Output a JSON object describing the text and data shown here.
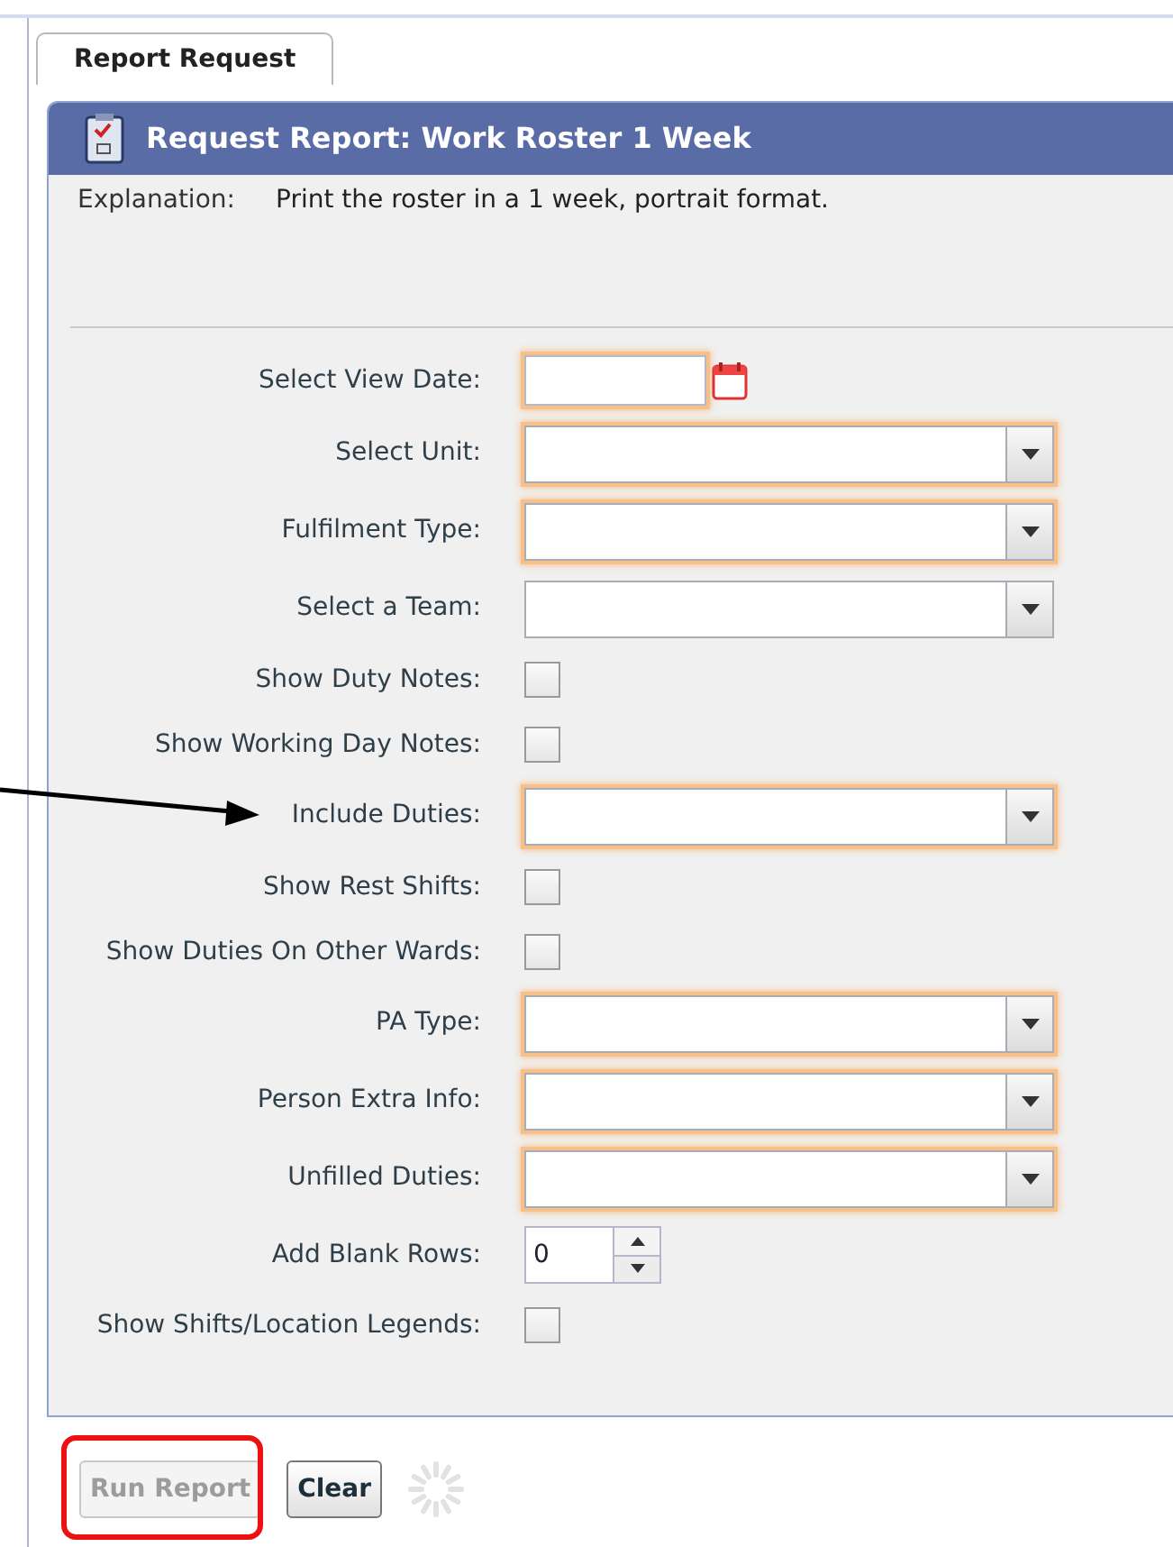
{
  "tab": {
    "label": "Report Request",
    "selected": true
  },
  "panel": {
    "title": "Request Report: Work Roster 1 Week",
    "explanation_label": "Explanation:",
    "explanation": "Print the roster in a 1 week, portrait format."
  },
  "fields": [
    {
      "kind": "date",
      "label": "Select View Date:",
      "highlighted": true
    },
    {
      "kind": "select",
      "label": "Select Unit:",
      "highlighted": true
    },
    {
      "kind": "select",
      "label": "Fulfilment Type:",
      "highlighted": true
    },
    {
      "kind": "select",
      "label": "Select a Team:",
      "highlighted": false
    },
    {
      "kind": "checkbox",
      "label": "Show Duty Notes:",
      "checked": false
    },
    {
      "kind": "checkbox",
      "label": "Show Working Day Notes:",
      "checked": false
    },
    {
      "kind": "select",
      "label": "Include Duties:",
      "highlighted": true
    },
    {
      "kind": "checkbox",
      "label": "Show Rest Shifts:",
      "checked": false
    },
    {
      "kind": "checkbox",
      "label": "Show Duties On Other Wards:",
      "checked": false
    },
    {
      "kind": "select",
      "label": "PA Type:",
      "highlighted": true
    },
    {
      "kind": "select",
      "label": "Person Extra Info:",
      "highlighted": true
    },
    {
      "kind": "select",
      "label": "Unfilled Duties:",
      "highlighted": true
    },
    {
      "kind": "spinner",
      "label": "Add Blank Rows:",
      "value": "0"
    },
    {
      "kind": "checkbox",
      "label": "Show Shifts/Location Legends:",
      "checked": false
    }
  ],
  "buttons": [
    {
      "label": "Run Report",
      "disabled": true
    },
    {
      "label": "Clear",
      "disabled": false
    }
  ]
}
